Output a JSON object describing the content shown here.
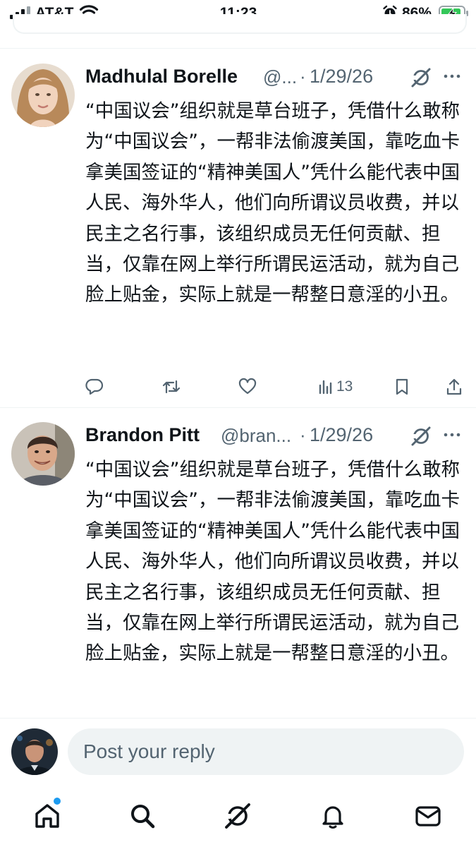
{
  "status_bar": {
    "carrier": "AT&T",
    "time": "11:23",
    "battery_percent": "86%"
  },
  "posts": [
    {
      "name": "Madhulal Borelle",
      "handle": "@...",
      "date": "1/29/26",
      "text": "“中国议会”组织就是草台班子，凭借什么敢称为“中国议会”，一帮非法偷渡美国，靠吃血卡拿美国签证的“精神美国人”凭什么能代表中国人民、海外华人，他们向所谓议员收费，并以民主之名行事，该组织成员无任何贡献、担当，仅靠在网上举行所谓民运活动，就为自己脸上贴金，实际上就是一帮整日意淫的小丑。",
      "views": "13"
    },
    {
      "name": "Brandon Pitt",
      "handle": "@bran...",
      "date": "1/29/26",
      "text": "“中国议会”组织就是草台班子，凭借什么敢称为“中国议会”，一帮非法偷渡美国，靠吃血卡拿美国签证的“精神美国人”凭什么能代表中国人民、海外华人，他们向所谓议员收费，并以民主之名行事，该组织成员无任何贡献、担当，仅靠在网上举行所谓民运活动，就为自己脸上贴金，实际上就是一帮整日意淫的小丑。"
    }
  ],
  "reply": {
    "placeholder": "Post your reply"
  },
  "nav": {
    "items": [
      "home-icon",
      "search-icon",
      "grok-icon",
      "notifications-icon",
      "messages-icon"
    ],
    "active": "home",
    "home_has_indicator": true
  },
  "colors": {
    "accent": "#1d9bf0",
    "secondary_text": "#536471",
    "primary_text": "#0f1419",
    "divider": "#eff3f4",
    "battery_charging": "#34c759"
  }
}
